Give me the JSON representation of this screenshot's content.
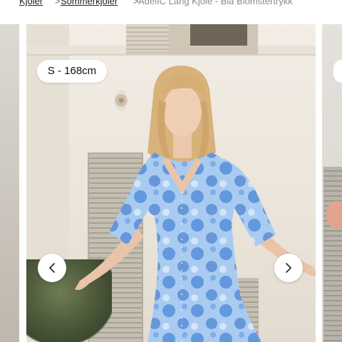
{
  "breadcrumb": {
    "items": [
      "Kjoler",
      "Sommerkjoler"
    ],
    "separator": ">",
    "current": "AdelIC Lang Kjole - Blå Blomstertrykk"
  },
  "gallery": {
    "size_label": "S - 168cm",
    "prev_icon": "chevron-left-icon",
    "next_icon": "chevron-right-icon"
  },
  "colors": {
    "dress_blue": "#9ec3ee",
    "dress_print": "#3f7fd6",
    "button_bg": "#ffffff"
  }
}
